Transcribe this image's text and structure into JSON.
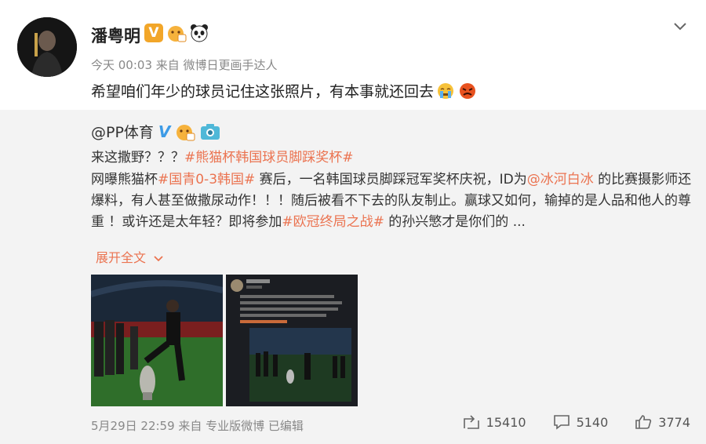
{
  "post": {
    "author": "潘粤明",
    "meta": "今天 00:03 来自 微博日更画手达人",
    "text": "希望咱们年少的球员记住这张照片，有本事就还回去"
  },
  "repost": {
    "author": "@PP体育",
    "line1_prefix": "来这撒野？？？",
    "line1_tag": "#熊猫杯韩国球员脚踩奖杯#",
    "body_part1": "网曝熊猫杯",
    "body_tag1": "#国青0-3韩国#",
    "body_part2": " 赛后，一名韩国球员脚踩冠军奖杯庆祝，ID为",
    "body_mention": "@冰河白冰",
    "body_part3": " 的比赛摄影师还爆料，有人甚至做撒尿动作！！！随后被看不下去的队友制止。赢球又如何，输掉的是人品和他人的尊重 ！或许还是太年轻？即将参加",
    "body_tag2": "#欧冠终局之战#",
    "body_part4": " 的孙兴慜才是你们的 ...",
    "expand_label": "展开全文",
    "footer": "5月29日 22:59 来自 专业版微博   已编辑",
    "reposts": "15410",
    "comments": "5140",
    "likes": "3774"
  },
  "icons": [
    "chevron-down-icon",
    "verified-v-icon",
    "emoji-icon",
    "panda-icon",
    "camera-icon",
    "share-icon",
    "comment-icon",
    "like-icon"
  ],
  "colors": {
    "accent": "#eb7350",
    "verified": "#f2a629",
    "blue_v": "#3d9be6"
  }
}
